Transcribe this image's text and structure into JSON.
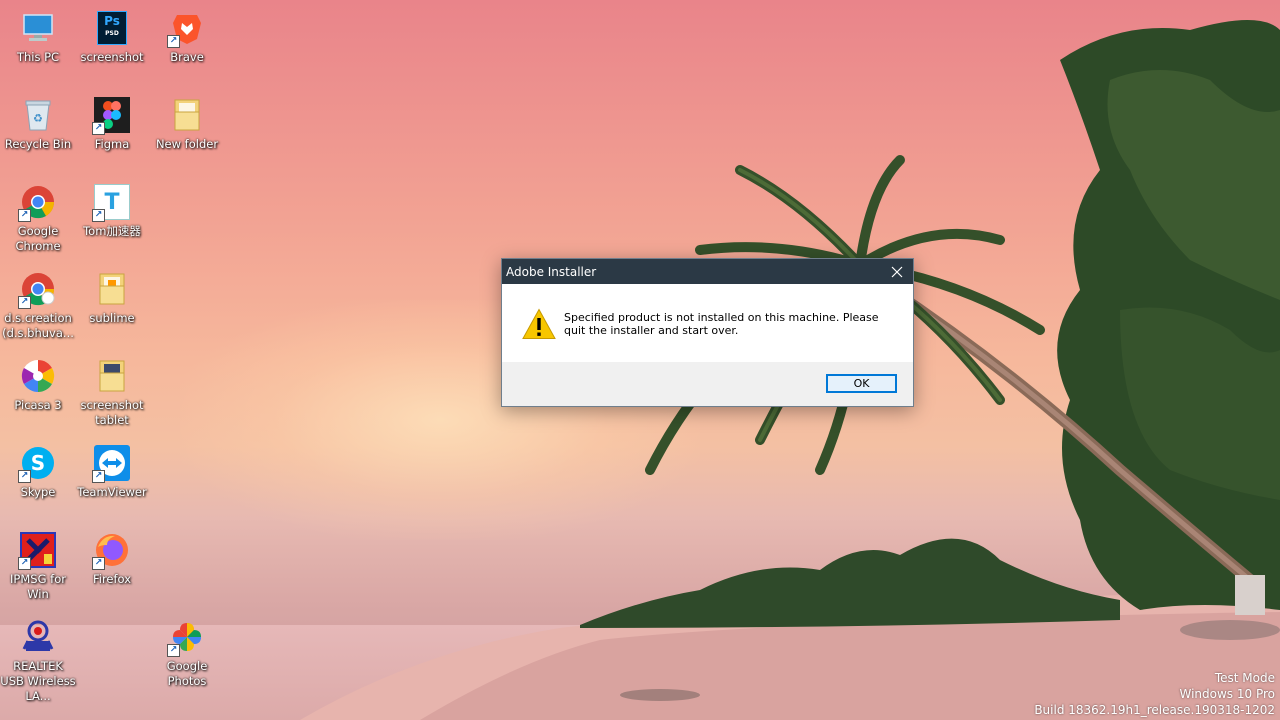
{
  "desktop": {
    "icons": [
      {
        "label": "This PC",
        "icon": "this-pc-icon"
      },
      {
        "label": "screenshot",
        "icon": "photoshop-icon",
        "glyph_text": "Ps",
        "sub_text": "PSD"
      },
      {
        "label": "Brave",
        "icon": "brave-icon"
      },
      {
        "label": "Recycle Bin",
        "icon": "recycle-bin-icon"
      },
      {
        "label": "Figma",
        "icon": "figma-icon"
      },
      {
        "label": "New folder",
        "icon": "folder-icon"
      },
      {
        "label": "Google Chrome",
        "icon": "chrome-icon"
      },
      {
        "label": "Tom加速器",
        "icon": "tom-accelerator-icon",
        "glyph_text": "T"
      },
      {
        "label": "d.s.creation (d.s.bhuva...",
        "icon": "chrome-profile-icon"
      },
      {
        "label": "sublime",
        "icon": "folder-icon"
      },
      {
        "label": "Picasa 3",
        "icon": "picasa-icon"
      },
      {
        "label": "screenshot tablet",
        "icon": "folder-icon"
      },
      {
        "label": "Skype",
        "icon": "skype-icon",
        "glyph_text": "S"
      },
      {
        "label": "TeamViewer",
        "icon": "teamviewer-icon"
      },
      {
        "label": "IPMSG for Win",
        "icon": "ipmsg-icon"
      },
      {
        "label": "Firefox",
        "icon": "firefox-icon"
      },
      {
        "label": "REALTEK USB Wireless LA...",
        "icon": "realtek-icon"
      },
      {
        "label": "Google Photos",
        "icon": "google-photos-icon"
      }
    ]
  },
  "dialog": {
    "title": "Adobe Installer",
    "message": "Specified product is not installed on this machine. Please quit the installer and start over.",
    "ok_label": "OK",
    "close_glyph": "✕"
  },
  "watermark": {
    "line1": "Test Mode",
    "line2": "Windows 10 Pro",
    "line3": "Build 18362.19h1_release.190318-1202"
  },
  "colors": {
    "titlebar": "#2b3945",
    "accent": "#0078d7",
    "warning": "#f7c600"
  }
}
